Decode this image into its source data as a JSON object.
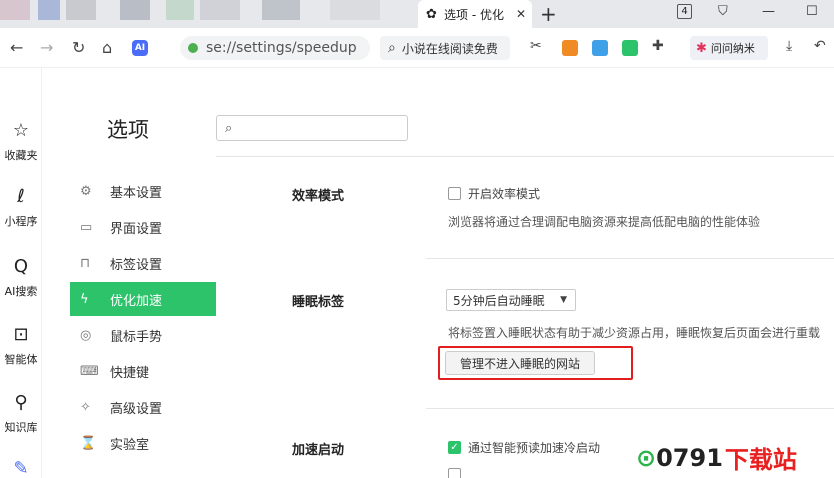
{
  "browser": {
    "tab_title": "选项 - 优化",
    "tab_count": "4",
    "address": "se://settings/speedup",
    "search_query": "小说在线阅读免费",
    "extension_label": "问问纳米"
  },
  "rail": {
    "items": [
      {
        "label": "收藏夹",
        "icon": "star-icon"
      },
      {
        "label": "小程序",
        "icon": "mini-program-icon"
      },
      {
        "label": "AI搜索",
        "icon": "search-icon"
      },
      {
        "label": "智能体",
        "icon": "agent-icon"
      },
      {
        "label": "知识库",
        "icon": "lightbulb-icon"
      }
    ]
  },
  "settings": {
    "title": "选项",
    "search_placeholder": "",
    "menu": [
      {
        "label": "基本设置",
        "icon": "gear-icon"
      },
      {
        "label": "界面设置",
        "icon": "window-icon"
      },
      {
        "label": "标签设置",
        "icon": "tab-icon"
      },
      {
        "label": "优化加速",
        "icon": "lightning-icon",
        "active": true
      },
      {
        "label": "鼠标手势",
        "icon": "mouse-icon"
      },
      {
        "label": "快捷键",
        "icon": "keyboard-icon"
      },
      {
        "label": "高级设置",
        "icon": "wrench-icon"
      },
      {
        "label": "实验室",
        "icon": "flask-icon"
      }
    ]
  },
  "sections": {
    "efficiency": {
      "title": "效率模式",
      "checkbox": "开启效率模式",
      "checked": false,
      "desc": "浏览器将通过合理调配电脑资源来提高低配电脑的性能体验"
    },
    "sleep": {
      "title": "睡眠标签",
      "select_value": "5分钟后自动睡眠",
      "desc": "将标签置入睡眠状态有助于减少资源占用，睡眠恢复后页面会进行重载",
      "button": "管理不进入睡眠的网站"
    },
    "boost": {
      "title": "加速启动",
      "checkbox": "通过智能预读加速冷启动",
      "checked": true
    }
  },
  "watermark": {
    "text1": "0791",
    "text2": "下载站"
  },
  "colors": {
    "accent": "#2cc36b",
    "highlight": "#e02020"
  }
}
